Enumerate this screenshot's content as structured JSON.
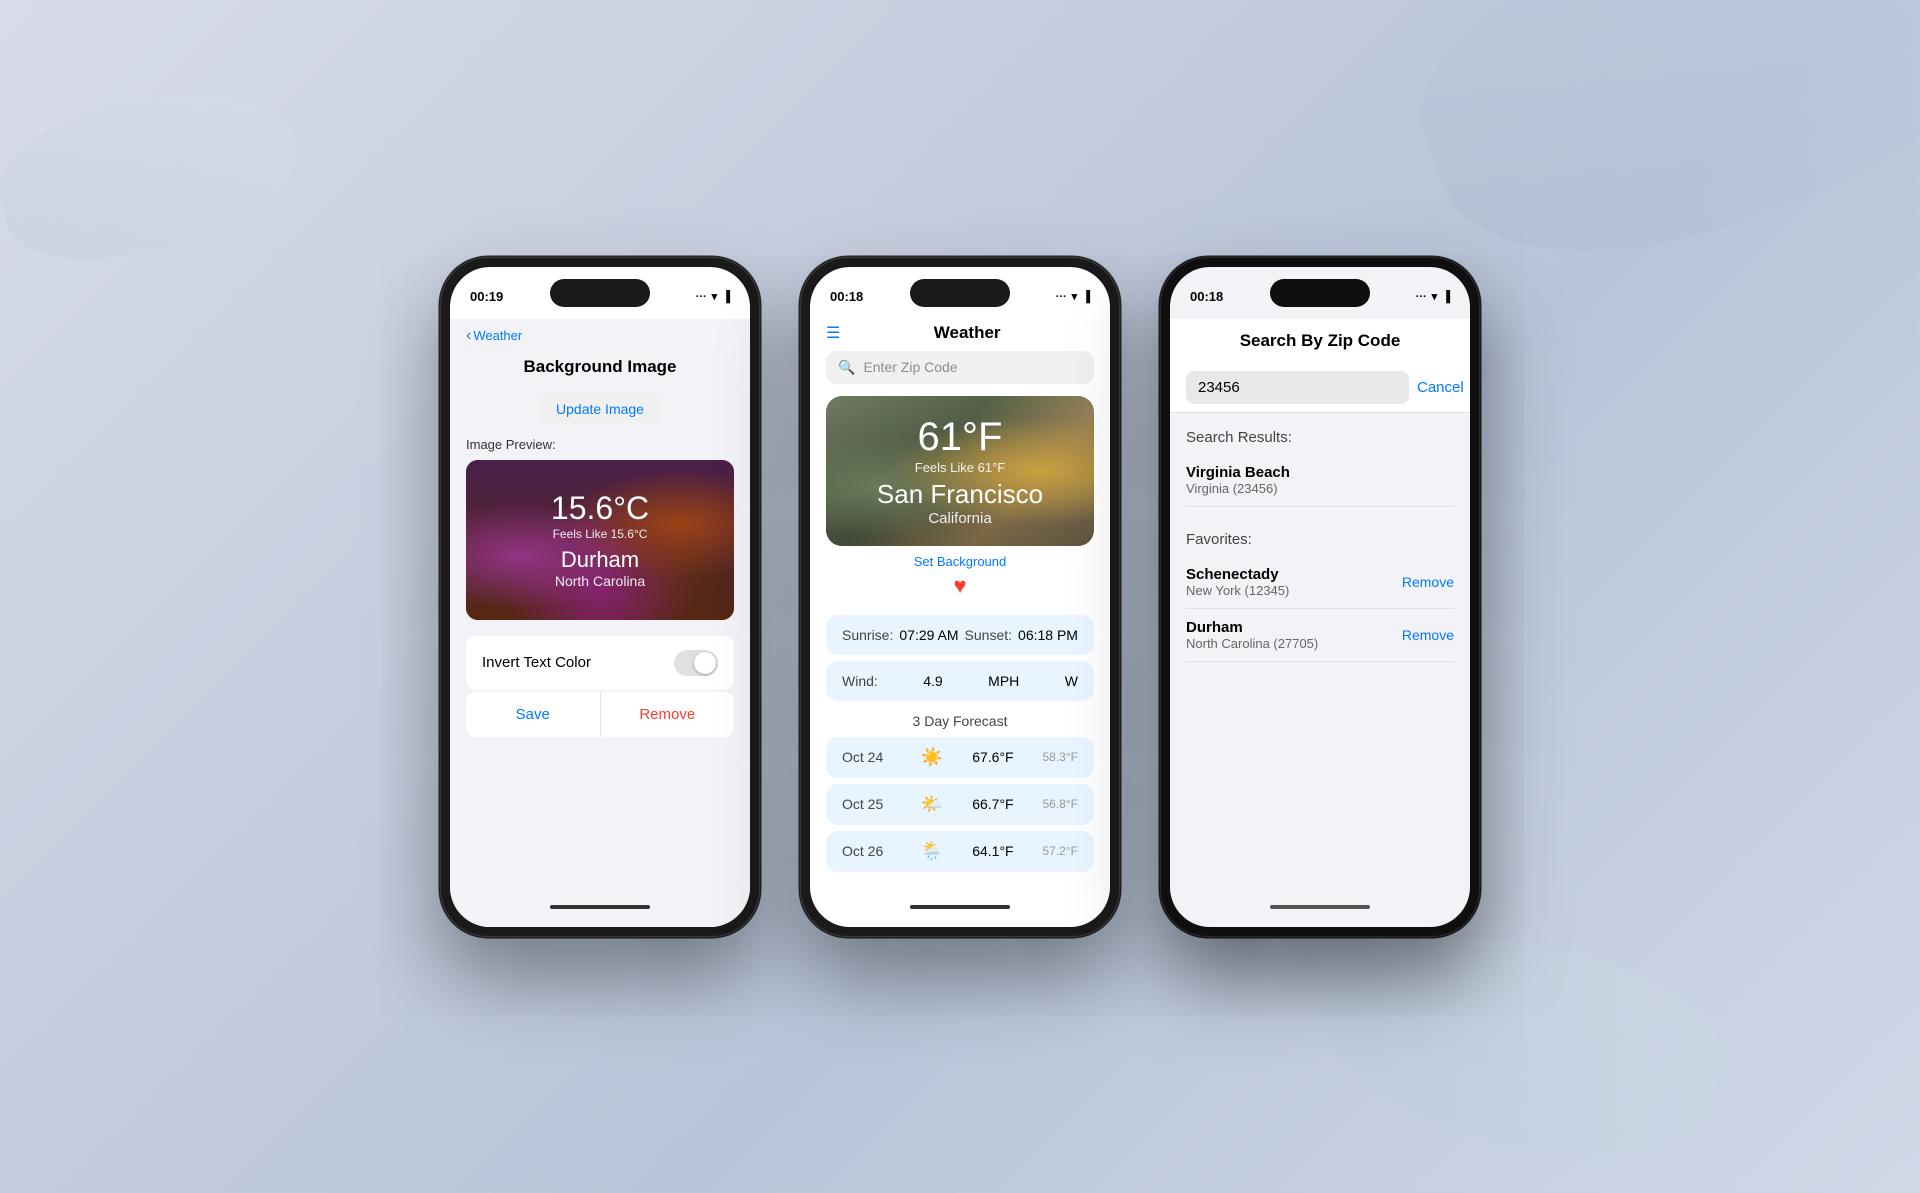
{
  "phone1": {
    "status_time": "00:19",
    "nav_back": "Weather",
    "nav_title": "Background Image",
    "update_btn": "Update Image",
    "image_preview_label": "Image Preview:",
    "preview_temp": "15.6°C",
    "preview_feels": "Feels Like 15.6°C",
    "preview_city": "Durham",
    "preview_state": "North Carolina",
    "invert_label": "Invert Text Color",
    "save_label": "Save",
    "remove_label": "Remove"
  },
  "phone2": {
    "status_time": "00:18",
    "nav_title": "Weather",
    "search_placeholder": "Enter Zip Code",
    "hero_temp": "61°F",
    "hero_feels": "Feels Like 61°F",
    "hero_city": "San Francisco",
    "hero_state": "California",
    "set_background": "Set Background",
    "sunrise_label": "Sunrise:",
    "sunrise_value": "07:29 AM",
    "sunset_label": "Sunset:",
    "sunset_value": "06:18 PM",
    "wind_label": "Wind:",
    "wind_value": "4.9",
    "wind_unit": "MPH",
    "wind_dir": "W",
    "forecast_title": "3 Day Forecast",
    "forecast": [
      {
        "date": "Oct 24",
        "icon": "☀️",
        "high": "67.6°F",
        "low": "58.3°F"
      },
      {
        "date": "Oct 25",
        "icon": "🌤️",
        "high": "66.7°F",
        "low": "56.8°F"
      },
      {
        "date": "Oct 26",
        "icon": "🌦️",
        "high": "64.1°F",
        "low": "57.2°F"
      }
    ]
  },
  "phone3": {
    "status_time": "00:18",
    "page_title": "Search By Zip Code",
    "zip_value": "23456",
    "cancel_label": "Cancel",
    "search_results_label": "Search Results:",
    "result_city": "Virginia Beach",
    "result_state": "Virginia (23456)",
    "favorites_label": "Favorites:",
    "favorites": [
      {
        "city": "Schenectady",
        "state": "New York (12345)",
        "action": "Remove"
      },
      {
        "city": "Durham",
        "state": "North Carolina (27705)",
        "action": "Remove"
      }
    ]
  }
}
